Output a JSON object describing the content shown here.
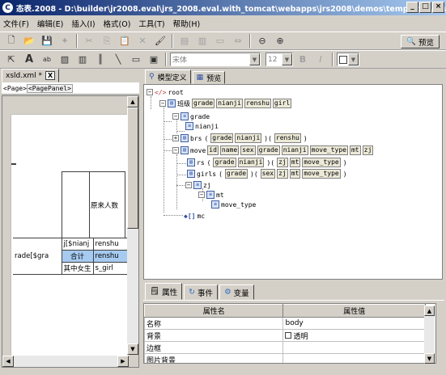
{
  "window": {
    "title": "态表.2008 - D:\\builder\\jr2008.eval\\jrs_2008.eval.with_tomcat\\webapps\\jrs2008\\demos\\templates\\edu\\b...",
    "min": "_",
    "max": "□",
    "close": "×"
  },
  "menu": [
    "文件(F)",
    "编辑(E)",
    "插入(I)",
    "格式(O)",
    "工具(T)",
    "帮助(H)"
  ],
  "toolbar": {
    "preview_label": "预览",
    "font_name": "宋体",
    "font_size": "12",
    "bold": "B",
    "italic": "I"
  },
  "left_panel": {
    "tab_label": "xsld.xml *",
    "close": "X",
    "crumb_page": "<Page>",
    "crumb_panel": "<PagePanel>",
    "table": {
      "header_cell": "原来人数",
      "row1": [
        "j[$nianj",
        "renshu"
      ],
      "row_left": "rade[$gra",
      "row2": [
        "合计",
        "renshu"
      ],
      "row3": [
        "其中女生",
        "s_girl"
      ]
    }
  },
  "tree_tabs": {
    "model": "模型定义",
    "preview": "预览"
  },
  "tree": {
    "root": "root",
    "banji": "班级",
    "banji_fields": [
      "grade",
      "nianji",
      "renshu",
      "girl"
    ],
    "grade": "grade",
    "nianji": "nianji",
    "brs": "brs",
    "brs_fields": [
      "grade",
      "nianji"
    ],
    "brs_extra": "renshu",
    "move": "move",
    "move_fields": [
      "id",
      "name",
      "sex",
      "grade",
      "nianji",
      "move_type",
      "mt",
      "zj"
    ],
    "rs": "rs",
    "rs_fields": [
      "grade",
      "nianji"
    ],
    "rs_extra": [
      "zj",
      "mt",
      "move_type"
    ],
    "girls": "girls",
    "girls_fields": [
      "grade"
    ],
    "girls_extra": [
      "sex",
      "zj",
      "mt",
      "move_type"
    ],
    "zj": "zj",
    "mt": "mt",
    "move_type": "move_type",
    "mc": "mc"
  },
  "prop_tabs": [
    "属性",
    "事件",
    "变量"
  ],
  "properties": {
    "col_name": "属性名",
    "col_value": "属性值",
    "rows": [
      {
        "name": "名称",
        "value": "body"
      },
      {
        "name": "背景",
        "value": "透明"
      },
      {
        "name": "边框",
        "value": ""
      },
      {
        "name": "图片背景",
        "value": ""
      }
    ]
  }
}
